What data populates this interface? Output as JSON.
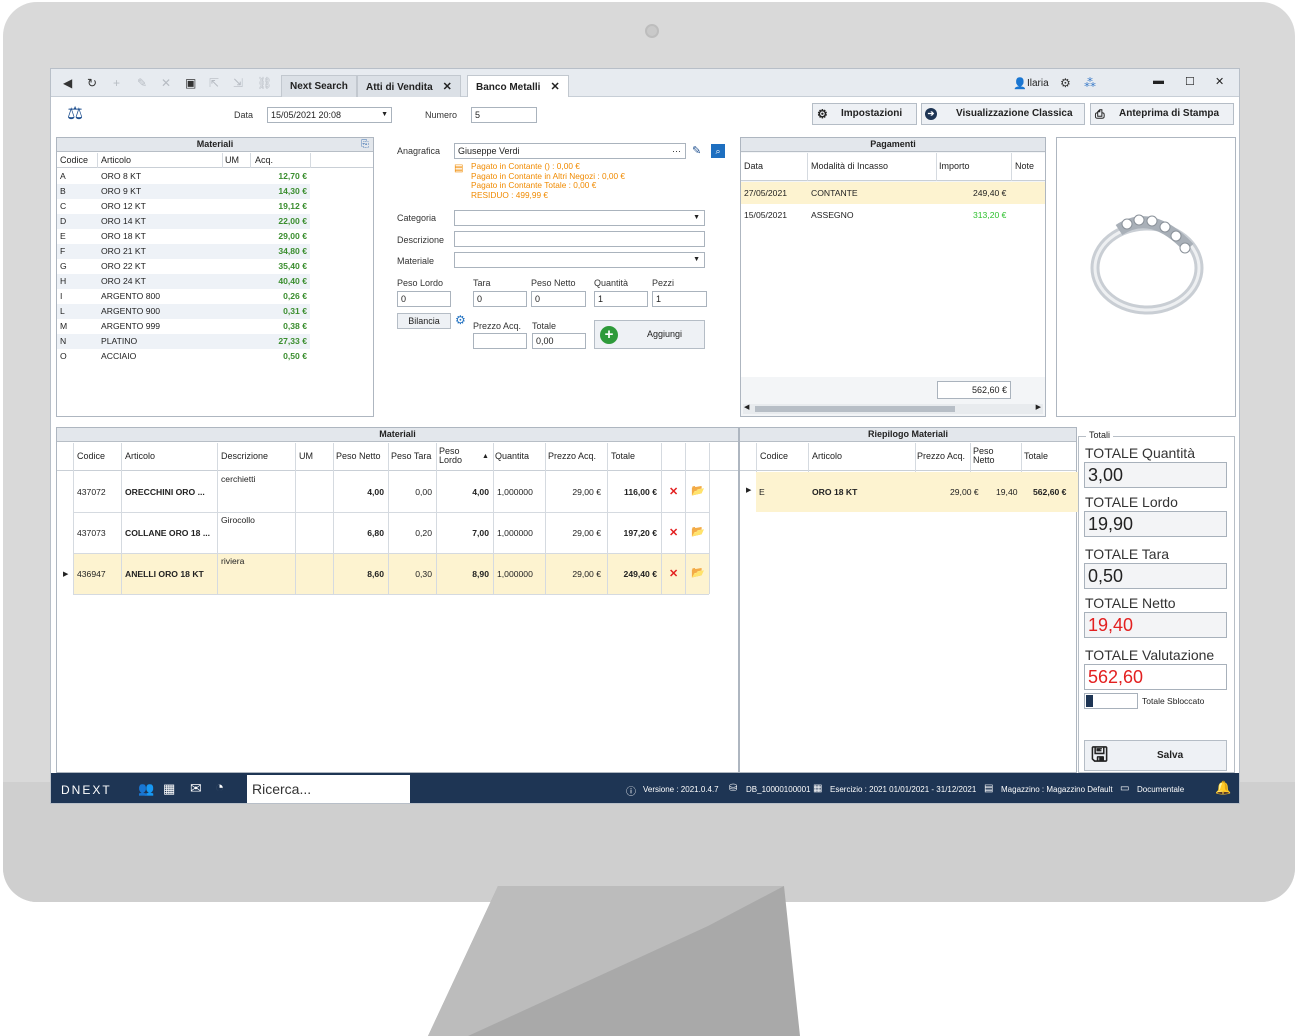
{
  "toolbar": {
    "tabs": [
      {
        "label": "Next Search"
      },
      {
        "label": "Atti di Vendita"
      },
      {
        "label": "Banco Metalli"
      }
    ],
    "user": "Ilaria"
  },
  "header": {
    "data_label": "Data",
    "data_value": "15/05/2021 20:08",
    "numero_label": "Numero",
    "numero_value": "5",
    "impostazioni": "Impostazioni",
    "visualizzazione": "Visualizzazione Classica",
    "anteprima": "Anteprima di Stampa"
  },
  "materiali_list": {
    "title": "Materiali",
    "columns": [
      "Codice",
      "Articolo",
      "UM",
      "Acq."
    ],
    "rows": [
      {
        "codice": "A",
        "articolo": "ORO 8 KT",
        "um": "",
        "acq": "12,70 €"
      },
      {
        "codice": "B",
        "articolo": "ORO 9 KT",
        "um": "",
        "acq": "14,30 €"
      },
      {
        "codice": "C",
        "articolo": "ORO 12 KT",
        "um": "",
        "acq": "19,12 €"
      },
      {
        "codice": "D",
        "articolo": "ORO 14 KT",
        "um": "",
        "acq": "22,00 €"
      },
      {
        "codice": "E",
        "articolo": "ORO 18 KT",
        "um": "",
        "acq": "29,00 €"
      },
      {
        "codice": "F",
        "articolo": "ORO 21 KT",
        "um": "",
        "acq": "34,80 €"
      },
      {
        "codice": "G",
        "articolo": "ORO 22 KT",
        "um": "",
        "acq": "35,40 €"
      },
      {
        "codice": "H",
        "articolo": "ORO 24 KT",
        "um": "",
        "acq": "40,40 €"
      },
      {
        "codice": "I",
        "articolo": "ARGENTO 800",
        "um": "",
        "acq": "0,26 €"
      },
      {
        "codice": "L",
        "articolo": "ARGENTO 900",
        "um": "",
        "acq": "0,31 €"
      },
      {
        "codice": "M",
        "articolo": "ARGENTO 999",
        "um": "",
        "acq": "0,38 €"
      },
      {
        "codice": "N",
        "articolo": "PLATINO",
        "um": "",
        "acq": "27,33 €"
      },
      {
        "codice": "O",
        "articolo": "ACCIAIO",
        "um": "",
        "acq": "0,50 €"
      }
    ]
  },
  "form": {
    "anagrafica_label": "Anagrafica",
    "anagrafica_value": "Giuseppe Verdi",
    "info_lines": [
      "Pagato in Contante () : 0,00 €",
      "Pagato in Contante in Altri Negozi : 0,00 €",
      "Pagato in Contante Totale : 0,00 €",
      "RESIDUO : 499,99 €"
    ],
    "categoria_label": "Categoria",
    "descrizione_label": "Descrizione",
    "materiale_label": "Materiale",
    "peso_lordo_label": "Peso Lordo",
    "peso_lordo_value": "0",
    "tara_label": "Tara",
    "tara_value": "0",
    "peso_netto_label": "Peso Netto",
    "peso_netto_value": "0",
    "quantita_label": "Quantità",
    "quantita_value": "1",
    "pezzi_label": "Pezzi",
    "pezzi_value": "1",
    "bilancia": "Bilancia",
    "prezzo_acq_label": "Prezzo Acq.",
    "prezzo_acq_value": "",
    "totale_label": "Totale",
    "totale_value": "0,00",
    "aggiungi": "Aggiungi"
  },
  "pagamenti": {
    "title": "Pagamenti",
    "columns": [
      "Data",
      "Modalità di Incasso",
      "Importo",
      "Note"
    ],
    "rows": [
      {
        "data": "27/05/2021",
        "modalita": "CONTANTE",
        "importo": "249,40 €",
        "note": ""
      },
      {
        "data": "15/05/2021",
        "modalita": "ASSEGNO",
        "importo": "313,20 €",
        "note": ""
      }
    ],
    "total": "562,60 €"
  },
  "materiali_grid": {
    "title": "Materiali",
    "columns": [
      "Codice",
      "Articolo",
      "Descrizione",
      "UM",
      "Peso Netto",
      "Peso Tara",
      "Peso Lordo",
      "Quantita",
      "Prezzo Acq.",
      "Totale"
    ],
    "rows": [
      {
        "codice": "437072",
        "articolo": "ORECCHINI ORO ...",
        "descrizione": "cerchietti",
        "um": "",
        "peso_netto": "4,00",
        "peso_tara": "0,00",
        "peso_lordo": "4,00",
        "quantita": "1,000000",
        "prezzo": "29,00 €",
        "totale": "116,00 €"
      },
      {
        "codice": "437073",
        "articolo": "COLLANE ORO 18 ...",
        "descrizione": "Girocollo",
        "um": "",
        "peso_netto": "6,80",
        "peso_tara": "0,20",
        "peso_lordo": "7,00",
        "quantita": "1,000000",
        "prezzo": "29,00 €",
        "totale": "197,20 €"
      },
      {
        "codice": "436947",
        "articolo": "ANELLI ORO 18 KT",
        "descrizione": "riviera",
        "um": "",
        "peso_netto": "8,60",
        "peso_tara": "0,30",
        "peso_lordo": "8,90",
        "quantita": "1,000000",
        "prezzo": "29,00 €",
        "totale": "249,40 €"
      }
    ]
  },
  "riepilogo": {
    "title": "Riepilogo Materiali",
    "columns": [
      "Codice",
      "Articolo",
      "Prezzo Acq.",
      "Peso Netto",
      "Totale"
    ],
    "rows": [
      {
        "codice": "E",
        "articolo": "ORO 18 KT",
        "prezzo": "29,00 €",
        "peso_netto": "19,40",
        "totale": "562,60 €"
      }
    ]
  },
  "totali": {
    "group": "Totali",
    "quantita_label": "TOTALE Quantità",
    "quantita_value": "3,00",
    "lordo_label": "TOTALE Lordo",
    "lordo_value": "19,90",
    "tara_label": "TOTALE Tara",
    "tara_value": "0,50",
    "netto_label": "TOTALE Netto",
    "netto_value": "19,40",
    "valutazione_label": "TOTALE Valutazione",
    "valutazione_value": "562,60",
    "sbloccato_label": "Totale Sbloccato",
    "salva": "Salva"
  },
  "taskbar": {
    "logo": "DNEXT",
    "search_placeholder": "Ricerca...",
    "versione": "Versione : 2021.0.4.7",
    "db": "DB_10000100001",
    "esercizio": "Esercizio : 2021 01/01/2021 - 31/12/2021",
    "magazzino": "Magazzino : Magazzino Default",
    "documentale": "Documentale"
  },
  "colors": {
    "taskbar": "#1e3554",
    "highlight_row": "#fdf3d0",
    "accent_orange": "#f08a00",
    "red": "#e32020",
    "green": "#3b8e2f"
  }
}
